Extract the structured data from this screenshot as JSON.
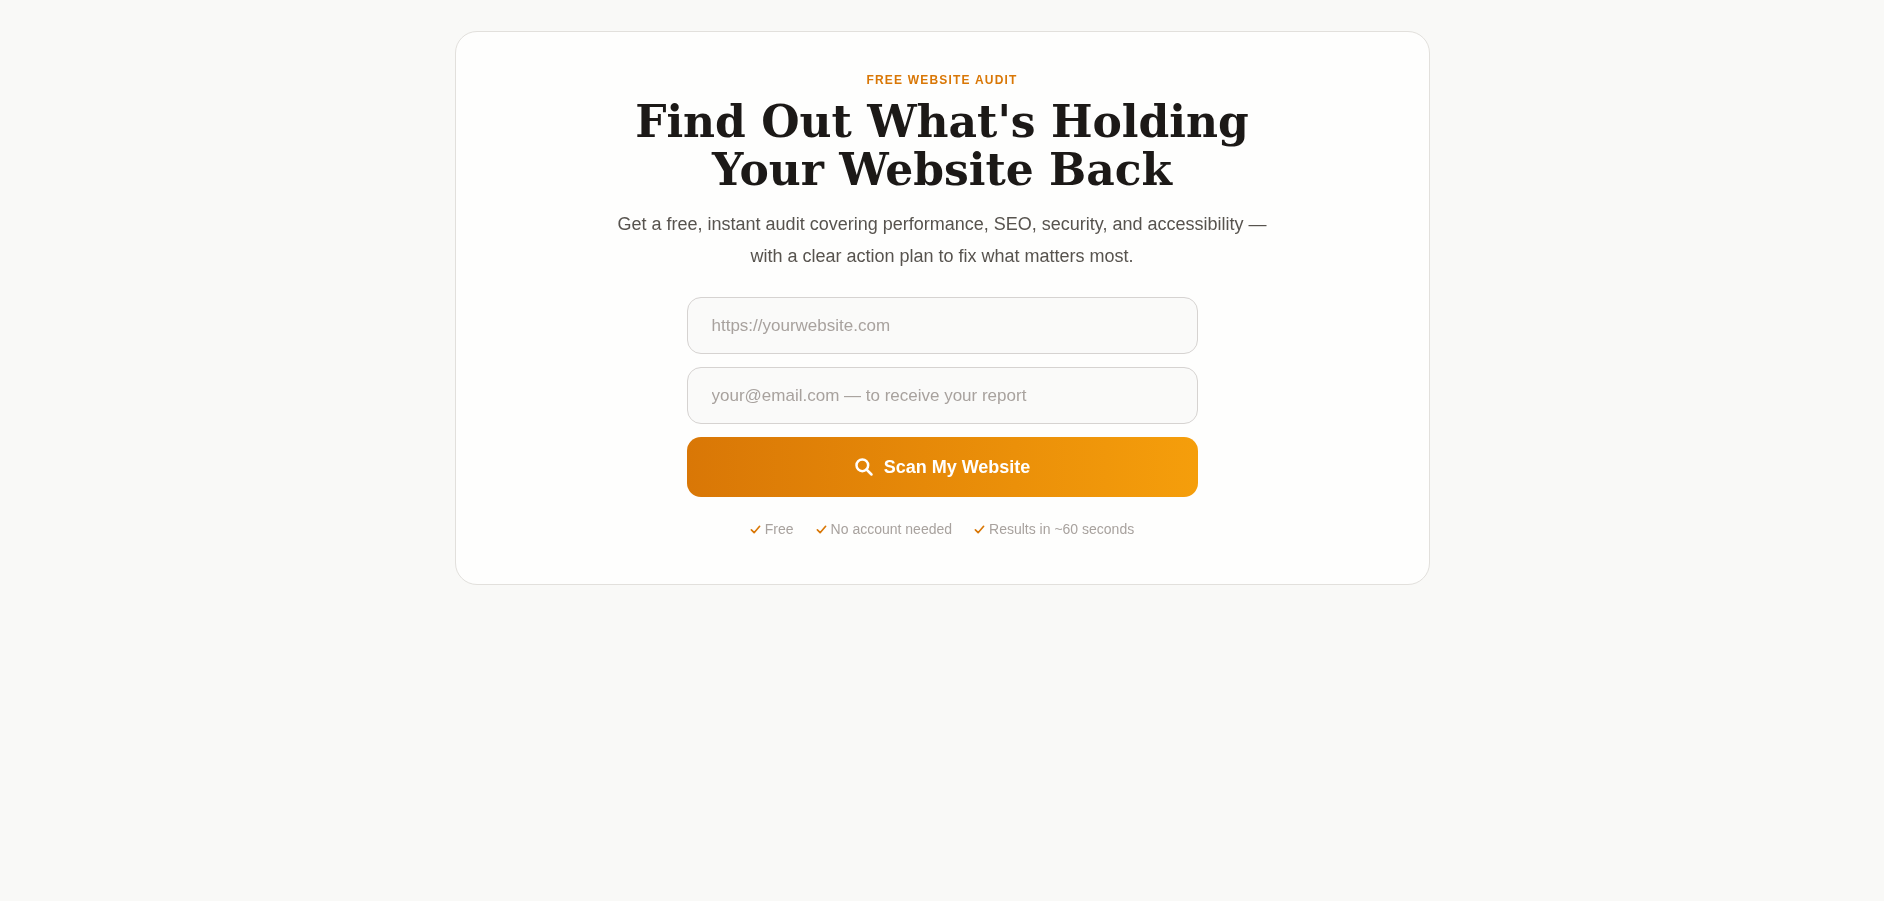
{
  "eyebrow": "FREE WEBSITE AUDIT",
  "headline": [
    "Find Out What's Holding",
    "Your Website Back"
  ],
  "subtitle": "Get a free, instant audit covering performance, SEO, security, and accessibility — with a clear action plan to fix what matters most.",
  "form": {
    "fields": [
      {
        "placeholder": "https://yourwebsite.com"
      },
      {
        "placeholder": "your@email.com — to receive your report"
      }
    ],
    "button": "Scan My Website"
  },
  "perks": [
    "Free",
    "No account needed",
    "Results in ~60 seconds"
  ]
}
